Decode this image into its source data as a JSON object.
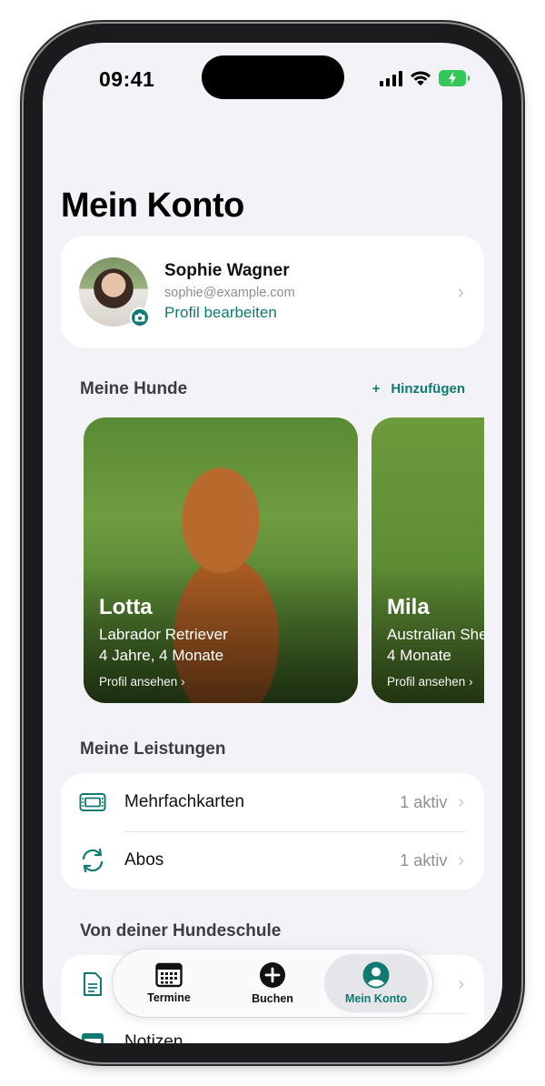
{
  "status": {
    "time": "09:41"
  },
  "page": {
    "title": "Mein Konto"
  },
  "profile": {
    "name": "Sophie Wagner",
    "email": "sophie@example.com",
    "edit_label": "Profil bearbeiten"
  },
  "dogs_section": {
    "title": "Meine Hunde",
    "add_label": "Hinzufügen",
    "dogs": [
      {
        "name": "Lotta",
        "breed": "Labrador Retriever",
        "age": "4 Jahre, 4 Monate",
        "link": "Profil ansehen"
      },
      {
        "name": "Mila",
        "breed": "Australian Shepherd",
        "age": "4 Monate",
        "link": "Profil ansehen"
      }
    ]
  },
  "services_section": {
    "title": "Meine Leistungen",
    "items": [
      {
        "label": "Mehrfachkarten",
        "value": "1 aktiv",
        "icon": "ticket-icon"
      },
      {
        "label": "Abos",
        "value": "1 aktiv",
        "icon": "refresh-icon"
      }
    ]
  },
  "school_section": {
    "title": "Von deiner Hundeschule",
    "items": [
      {
        "label": "",
        "icon": "document-icon"
      },
      {
        "label": "Notizen",
        "icon": "notes-icon"
      }
    ]
  },
  "tabbar": {
    "tabs": [
      {
        "label": "Termine",
        "icon": "calendar-icon"
      },
      {
        "label": "Buchen",
        "icon": "plus-circle-icon"
      },
      {
        "label": "Mein Konto",
        "icon": "person-circle-icon"
      }
    ],
    "active": "Mein Konto"
  },
  "colors": {
    "accent": "#0f7a72",
    "background": "#f2f2f7",
    "battery": "#34c759"
  }
}
